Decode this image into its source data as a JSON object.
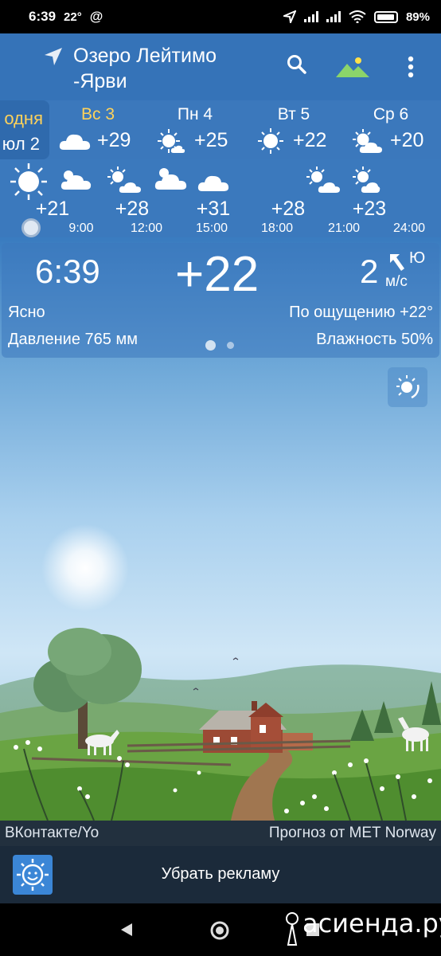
{
  "status_bar": {
    "time": "6:39",
    "temp_badge": "22°",
    "at_icon": "@",
    "battery": "89%",
    "icons": [
      "location-arrow-icon",
      "signal-icon",
      "signal-icon",
      "wifi-icon",
      "battery-icon"
    ]
  },
  "header": {
    "location_line1": "Озеро Лейтимо",
    "location_line2": "-Ярви",
    "icons": [
      "navigation-arrow-icon",
      "search-icon",
      "landscape-icon",
      "more-vert-icon"
    ]
  },
  "days": {
    "today_line1": "одня",
    "today_line2": "юл 2",
    "items": [
      {
        "name": "Вс 3",
        "temp": "+29",
        "icon": "cloud-icon",
        "highlight": true
      },
      {
        "name": "Пн 4",
        "temp": "+25",
        "icon": "sun-small-cloud-icon",
        "highlight": false
      },
      {
        "name": "Вт 5",
        "temp": "+22",
        "icon": "sun-icon",
        "highlight": false
      },
      {
        "name": "Ср 6",
        "temp": "+20",
        "icon": "sun-cloud-icon",
        "highlight": false
      }
    ]
  },
  "hourly": {
    "temps": [
      "+21",
      "+28",
      "+31",
      "+28",
      "+23"
    ],
    "times": [
      "9:00",
      "12:00",
      "15:00",
      "18:00",
      "21:00",
      "24:00"
    ],
    "icons": [
      "sun-icon",
      "cloud-icon",
      "sun-cloud-icon",
      "sun-cloud-icon",
      "cloud-icon",
      "sun-cloud-icon",
      "sun-cloud-icon"
    ]
  },
  "current": {
    "time": "6:39",
    "temp": "+22",
    "wind_speed": "2",
    "wind_dir": "Ю",
    "wind_unit": "м/с",
    "condition": "Ясно",
    "feels_like": "По ощущению +22°",
    "pressure": "Давление 765 мм",
    "humidity": "Влажность 50%"
  },
  "credits": {
    "left": "ВКонтакте/Yo",
    "right": "Прогноз от MET Norway"
  },
  "ad": {
    "label": "Убрать рекламу"
  },
  "watermark": "асиенда.ру",
  "colors": {
    "accent_day": "#ffd25a",
    "header_bg": "#3573b8"
  }
}
